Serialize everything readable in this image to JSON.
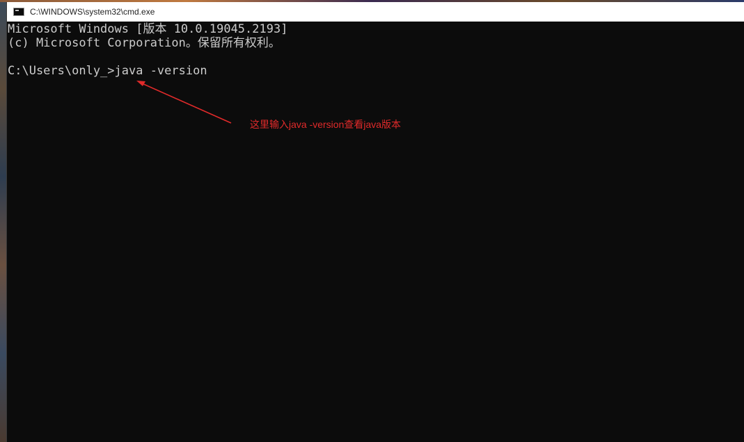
{
  "window": {
    "title": "C:\\WINDOWS\\system32\\cmd.exe",
    "icon": "cmd-icon"
  },
  "console": {
    "lines": [
      "Microsoft Windows [版本 10.0.19045.2193]",
      "(c) Microsoft Corporation。保留所有权利。",
      "",
      "C:\\Users\\only_>java -version"
    ]
  },
  "annotation": {
    "text": "这里输入java -version查看java版本",
    "color": "#e12a2a"
  },
  "colors": {
    "console_bg": "#0c0c0c",
    "console_fg": "#cccccc",
    "title_bg": "#ffffff"
  }
}
